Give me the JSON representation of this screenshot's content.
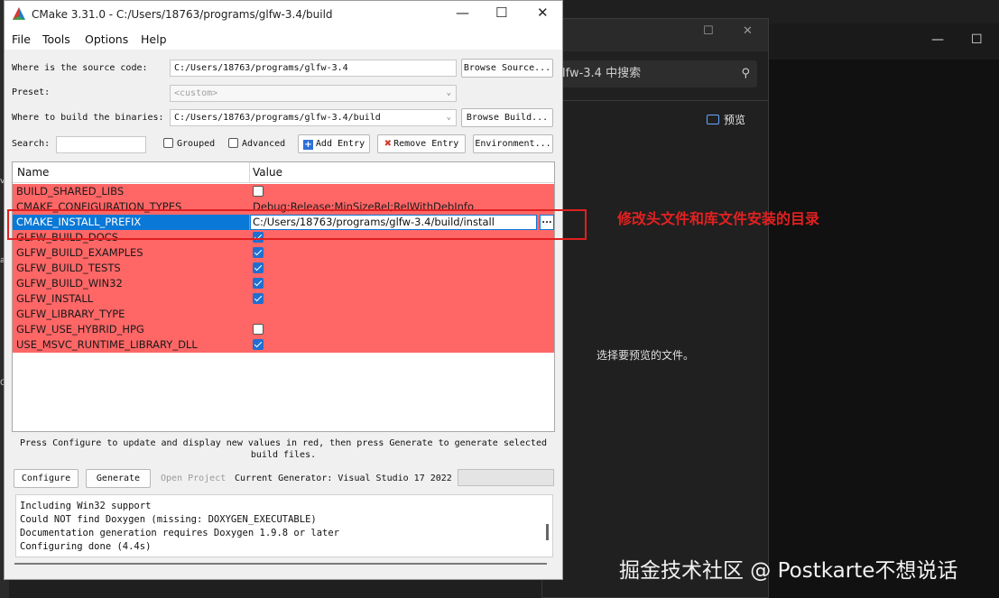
{
  "cmake": {
    "title": "CMake 3.31.0 - C:/Users/18763/programs/glfw-3.4/build",
    "menu": [
      "File",
      "Tools",
      "Options",
      "Help"
    ],
    "source_label": "Where is the source code:",
    "source_value": "C:/Users/18763/programs/glfw-3.4",
    "browse_source": "Browse Source...",
    "preset_label": "Preset:",
    "preset_value": "<custom>",
    "build_label": "Where to build the binaries:",
    "build_value": "C:/Users/18763/programs/glfw-3.4/build",
    "browse_build": "Browse Build...",
    "search_label": "Search:",
    "search_value": "",
    "grouped": "Grouped",
    "advanced": "Advanced",
    "add_entry": "Add Entry",
    "remove_entry": "Remove Entry",
    "environment": "Environment...",
    "col_name": "Name",
    "col_value": "Value",
    "entries": [
      {
        "name": "BUILD_SHARED_LIBS",
        "type": "bool",
        "checked": false
      },
      {
        "name": "CMAKE_CONFIGURATION_TYPES",
        "type": "text",
        "value": "Debug;Release;MinSizeRel;RelWithDebInfo"
      },
      {
        "name": "CMAKE_INSTALL_PREFIX",
        "type": "edit",
        "value": "C:/Users/18763/programs/glfw-3.4/build/install",
        "selected": true
      },
      {
        "name": "GLFW_BUILD_DOCS",
        "type": "bool",
        "checked": true
      },
      {
        "name": "GLFW_BUILD_EXAMPLES",
        "type": "bool",
        "checked": true
      },
      {
        "name": "GLFW_BUILD_TESTS",
        "type": "bool",
        "checked": true
      },
      {
        "name": "GLFW_BUILD_WIN32",
        "type": "bool",
        "checked": true
      },
      {
        "name": "GLFW_INSTALL",
        "type": "bool",
        "checked": true
      },
      {
        "name": "GLFW_LIBRARY_TYPE",
        "type": "text",
        "value": ""
      },
      {
        "name": "GLFW_USE_HYBRID_HPG",
        "type": "bool",
        "checked": false
      },
      {
        "name": "USE_MSVC_RUNTIME_LIBRARY_DLL",
        "type": "bool",
        "checked": true
      }
    ],
    "ellipsis": "...",
    "hint_line1": "Press Configure to update and display new values in red, then press Generate to generate selected",
    "hint_line2": "build files.",
    "configure": "Configure",
    "generate": "Generate",
    "open_project": "Open Project",
    "current_generator": "Current Generator: Visual Studio 17 2022",
    "output_lines": [
      "Including Win32 support",
      "Could NOT find Doxygen (missing: DOXYGEN_EXECUTABLE)",
      "Documentation generation requires Doxygen 1.9.8 or later",
      "Configuring done (4.4s)"
    ]
  },
  "annotation": "修改头文件和库文件安装的目录",
  "explorer": {
    "search_text": "lfw-3.4 中搜索",
    "preview_button": "预览",
    "preview_message": "选择要预览的文件。"
  },
  "watermark": "掘金技术社区 @ Postkarte不想说话",
  "colors": {
    "changed_row": "#ff6666",
    "selection": "#0a78d7",
    "annotation": "#e02020"
  }
}
